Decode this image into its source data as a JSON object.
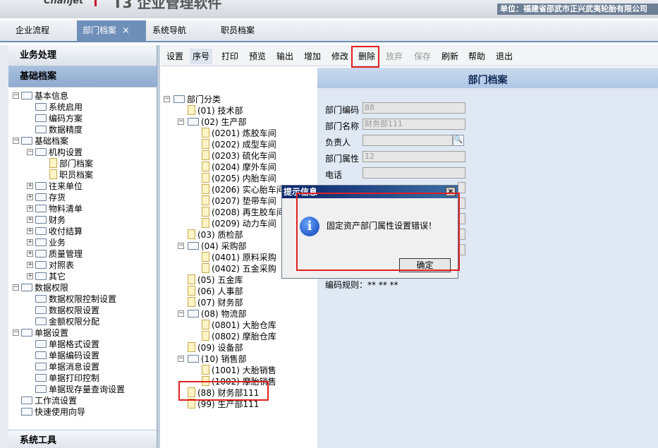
{
  "header": {
    "logo": "Chanjet",
    "app_title": "T3 企业管理软件",
    "unit": "单位：福建省邵武市正兴武夷轮胎有限公司"
  },
  "tabs": [
    {
      "label": "企业流程"
    },
    {
      "label": "部门档案"
    },
    {
      "label": "系统导航"
    },
    {
      "label": "职员档案"
    }
  ],
  "tab_close": "×",
  "sidebar": {
    "section_business": "业务处理",
    "section_base": "基础档案",
    "section_tools": "系统工具",
    "tree": [
      "基本信息",
      "系统启用",
      "编码方案",
      "数据精度",
      "基础档案",
      "机构设置",
      "部门档案",
      "职员档案",
      "往来单位",
      "存货",
      "物料清单",
      "财务",
      "收付结算",
      "业务",
      "质量管理",
      "对照表",
      "其它",
      "数据权限",
      "数据权限控制设置",
      "数据权限设置",
      "金额权限分配",
      "单据设置",
      "单据格式设置",
      "单据编码设置",
      "单据消息设置",
      "单据打印控制",
      "单据现存量查询设置",
      "工作流设置",
      "快速使用向导"
    ]
  },
  "toolbar": [
    "设置",
    "序号",
    "打印",
    "预览",
    "输出",
    "增加",
    "修改",
    "删除",
    "放弃",
    "保存",
    "刷新",
    "帮助",
    "退出"
  ],
  "dept_tree": [
    "部门分类",
    "(01) 技术部",
    "(02) 生产部",
    "(0201) 炼胶车间",
    "(0202) 成型车间",
    "(0203) 硫化车间",
    "(0204) 摩外车间",
    "(0205) 内胎车间",
    "(0206) 实心胎车间",
    "(0207) 垫带车间",
    "(0208) 再生胶车间",
    "(0209) 动力车间",
    "(03) 质检部",
    "(04) 采购部",
    "(0401) 原料采购",
    "(0402) 五金采购",
    "(05) 五金库",
    "(06) 人事部",
    "(07) 财务部",
    "(08) 物流部",
    "(0801) 大胎仓库",
    "(0802) 摩胎仓库",
    "(09) 设备部",
    "(10) 销售部",
    "(1001) 大胎销售",
    "(1002) 摩胎销售",
    "(88) 财务部111",
    "(99) 生产部111"
  ],
  "form": {
    "title": "部门档案",
    "code_label": "部门编码",
    "code_value": "88",
    "name_label": "部门名称",
    "name_value": "财务部111",
    "manager_label": "负责人",
    "manager_value": "",
    "attr_label": "部门属性",
    "attr_value": "12",
    "phone_label": "电话",
    "phone_value": "",
    "rule": "编码规则：** ** **",
    "lookup_icon": "magnifier-icon"
  },
  "dialog": {
    "title": "提示信息",
    "close": "×",
    "icon": "info-icon",
    "message": "固定资产部门属性设置错误！",
    "ok": "确定"
  }
}
